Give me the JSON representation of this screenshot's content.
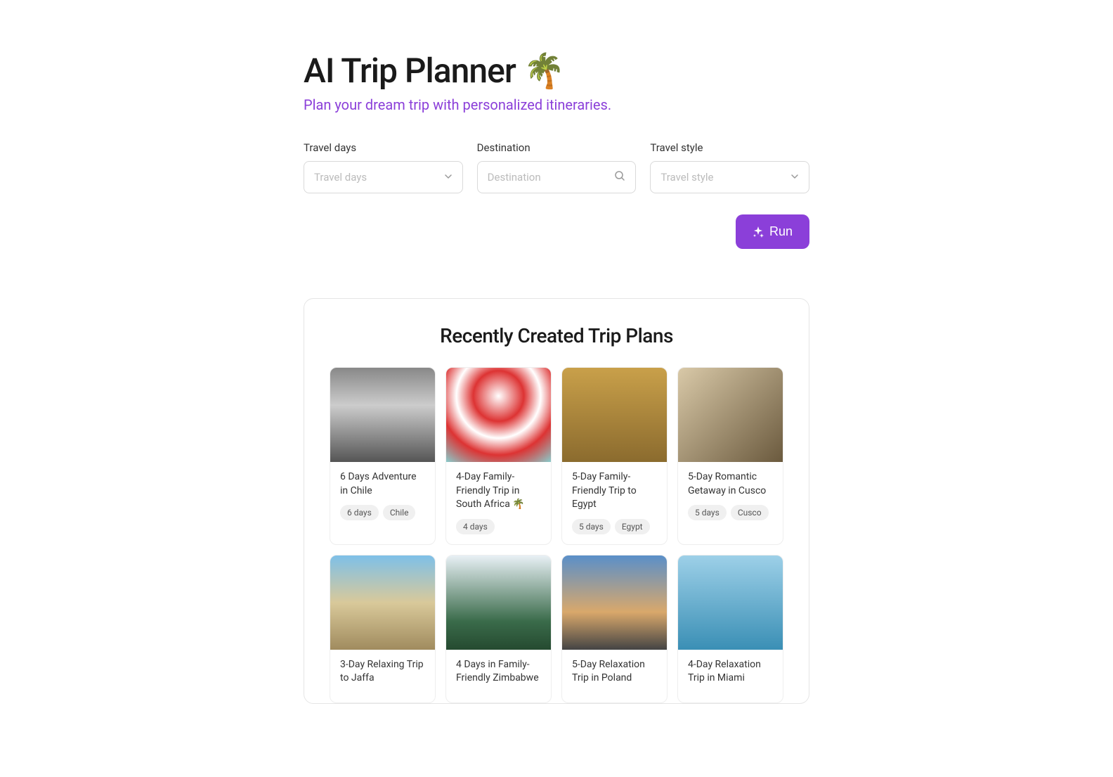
{
  "header": {
    "title": "AI Trip Planner 🌴",
    "subtitle": "Plan your dream trip with personalized itineraries."
  },
  "form": {
    "travel_days": {
      "label": "Travel days",
      "placeholder": "Travel days"
    },
    "destination": {
      "label": "Destination",
      "placeholder": "Destination"
    },
    "travel_style": {
      "label": "Travel style",
      "placeholder": "Travel style"
    },
    "run_button": "Run"
  },
  "recent": {
    "heading": "Recently Created Trip Plans",
    "cards": [
      {
        "title": "6 Days Adventure in Chile",
        "days": "6 days",
        "location": "Chile"
      },
      {
        "title": "4-Day Family-Friendly Trip in South Africa 🌴",
        "days": "4 days",
        "location": ""
      },
      {
        "title": "5-Day Family-Friendly Trip to Egypt",
        "days": "5 days",
        "location": "Egypt"
      },
      {
        "title": "5-Day Romantic Getaway in Cusco",
        "days": "5 days",
        "location": "Cusco"
      },
      {
        "title": "3-Day Relaxing Trip to Jaffa",
        "days": "",
        "location": ""
      },
      {
        "title": "4 Days in Family-Friendly Zimbabwe",
        "days": "",
        "location": ""
      },
      {
        "title": "5-Day Relaxation Trip in Poland",
        "days": "",
        "location": ""
      },
      {
        "title": "4-Day Relaxation Trip in Miami",
        "days": "",
        "location": ""
      }
    ]
  },
  "colors": {
    "accent": "#8b3fd9"
  }
}
